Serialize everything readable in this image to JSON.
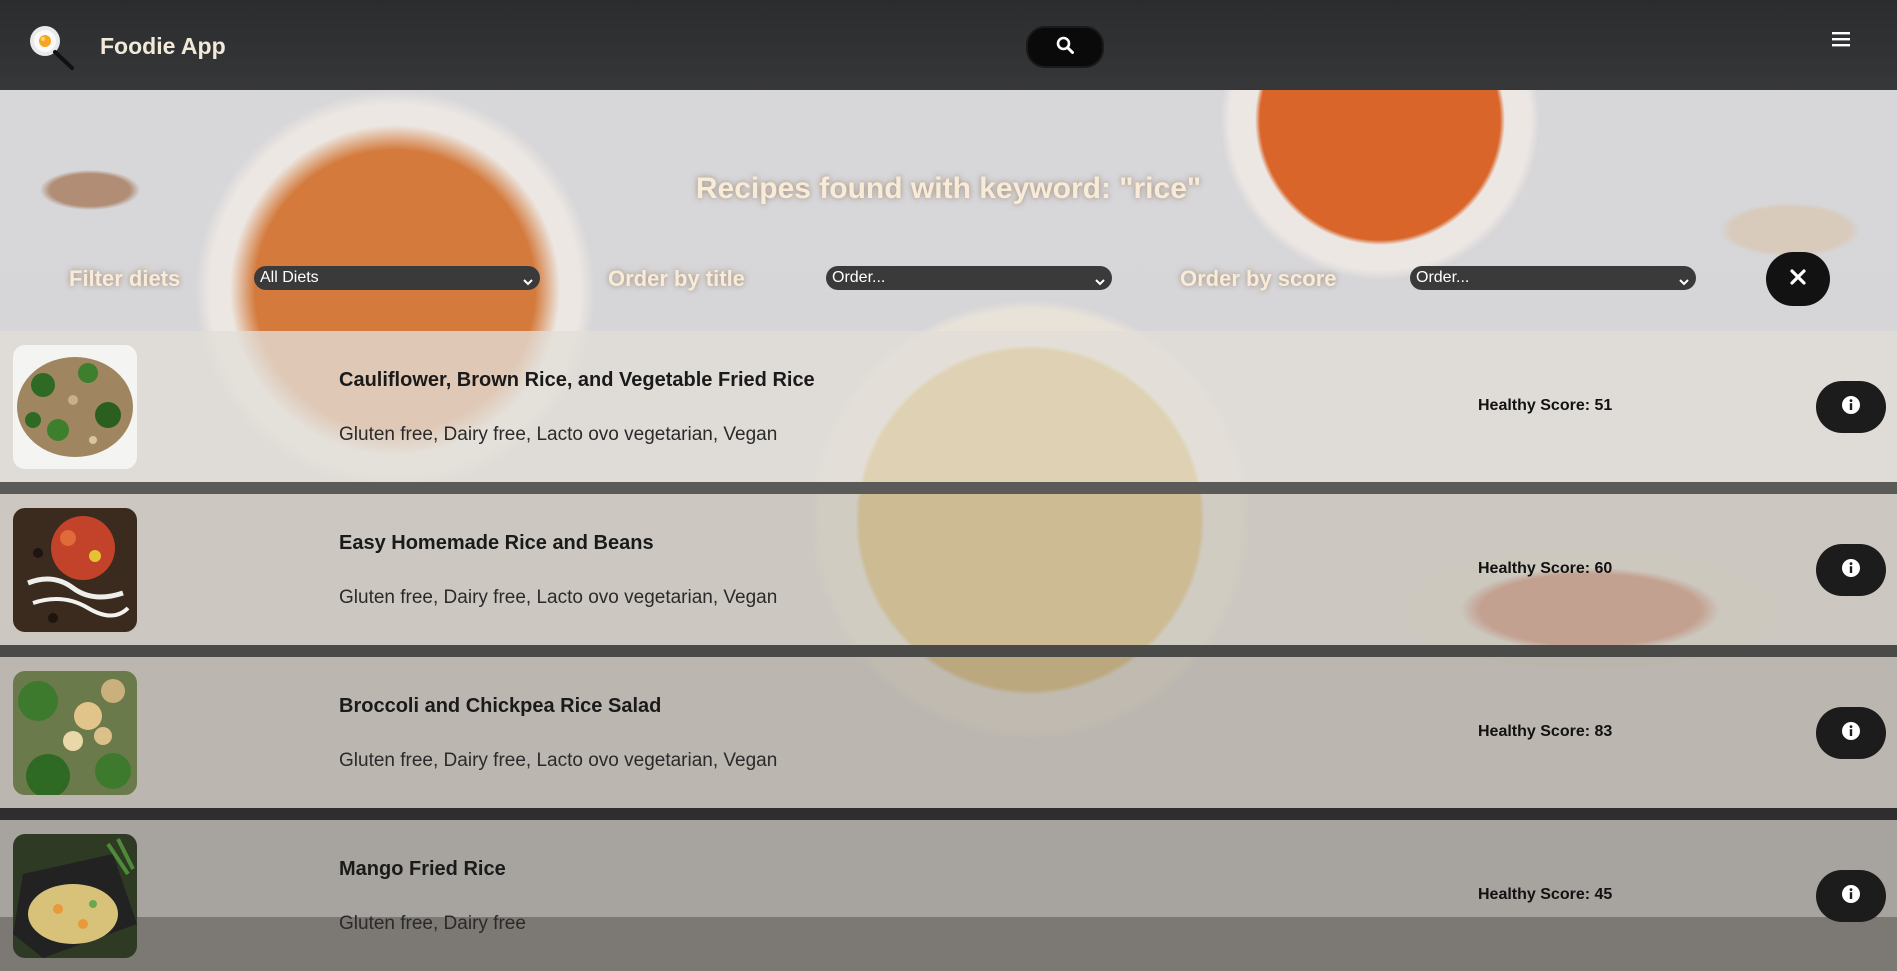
{
  "app": {
    "title": "Foodie App"
  },
  "icons": {
    "logo": "frying-pan-egg-icon",
    "search": "search-icon",
    "menu": "hamburger-menu-icon",
    "clear": "close-icon",
    "info": "info-icon",
    "chevron": "chevron-down-icon"
  },
  "heading": "Recipes found with keyword: \"rice\"",
  "filters": {
    "diet_label": "Filter diets",
    "diet_value": "All Diets",
    "title_label": "Order by title",
    "title_value": "Order...",
    "score_label": "Order by score",
    "score_value": "Order..."
  },
  "recipes": [
    {
      "title": "Cauliflower, Brown Rice, and Vegetable Fried Rice",
      "diets": "Gluten free, Dairy free, Lacto ovo vegetarian, Vegan",
      "score": "Healthy Score: 51"
    },
    {
      "title": "Easy Homemade Rice and Beans",
      "diets": "Gluten free, Dairy free, Lacto ovo vegetarian, Vegan",
      "score": "Healthy Score: 60"
    },
    {
      "title": "Broccoli and Chickpea Rice Salad",
      "diets": "Gluten free, Dairy free, Lacto ovo vegetarian, Vegan",
      "score": "Healthy Score: 83"
    },
    {
      "title": "Mango Fried Rice",
      "diets": "Gluten free, Dairy free",
      "score": "Healthy Score: 45"
    }
  ],
  "colors": {
    "topbar": "#2b2c2e",
    "accent_text": "#f8ecd8",
    "button_dark": "#121212"
  }
}
